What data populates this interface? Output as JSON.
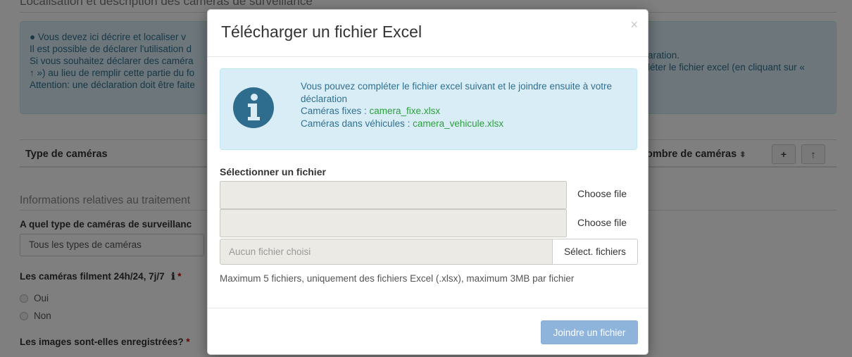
{
  "background": {
    "section_title": "Localisation et description des caméras de surveillance",
    "info_lines": [
      "Vous devez ici décrire et localiser v",
      "Il est possible de déclarer l'utilisation d",
      "Si vous souhaitez déclarer des caméra",
      "↑ ») au lieu de remplir cette partie du fo",
      "Attention: une déclaration doit être faite"
    ],
    "info_right_1": "aration.",
    "info_right_2": "léter le fichier excel (en cliquant sur «",
    "table_col_type": "Type de caméras",
    "table_col_count": "ombre de caméras",
    "sort_glyph": "⬍",
    "add_glyph": "+",
    "up_glyph": "↑",
    "subsection": "Informations relatives au traitement",
    "q1_label": "A quel type de caméras de surveillanc",
    "q1_value": "Tous les types de caméras",
    "q2_label": "Les caméras filment 24h/24, 7j/7",
    "q2_info_glyph": "ℹ",
    "required_mark": "*",
    "radio_yes": "Oui",
    "radio_no": "Non",
    "q3_label": "Les images sont-elles enregistrées?"
  },
  "modal": {
    "title": "Télécharger un fichier Excel",
    "close": "×",
    "alert": {
      "intro": "Vous pouvez compléter le fichier excel suivant et le joindre ensuite à votre déclaration",
      "fixed_label": "Caméras fixes : ",
      "fixed_link": "camera_fixe.xlsx",
      "vehicle_label": "Caméras dans véhicules : ",
      "vehicle_link": "camera_vehicule.xlsx"
    },
    "select_label": "Sélectionner un fichier",
    "choose_file": "Choose file",
    "multi_placeholder": "Aucun fichier choisi",
    "multi_button": "Sélect. fichiers",
    "help": "Maximum 5 fichiers, uniquement des fichiers Excel (.xlsx), maximum 3MB par fichier",
    "submit": "Joindre un fichier"
  },
  "colors": {
    "info_bg": "#d9edf7",
    "info_text": "#31708f",
    "link_green": "#2e9e3e",
    "primary_disabled": "#8fb4dc",
    "icon_dark": "#2f6d8e"
  }
}
